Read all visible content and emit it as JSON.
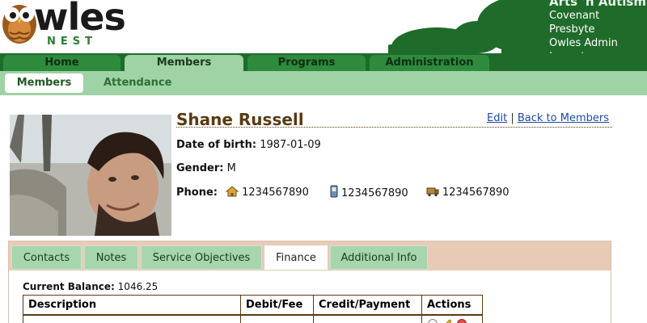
{
  "header": {
    "logo_main": "wles",
    "logo_sub": "NEST",
    "org_name": "Arts 'n Autism",
    "org_sub": "Covenant Presbyte",
    "user_name": "Owles Admin",
    "logout_label": "Logout"
  },
  "main_nav": {
    "tabs": [
      {
        "label": "Home"
      },
      {
        "label": "Members"
      },
      {
        "label": "Programs"
      },
      {
        "label": "Administration"
      }
    ],
    "active": "Members"
  },
  "sub_nav": {
    "tabs": [
      {
        "label": "Members"
      },
      {
        "label": "Attendance"
      }
    ],
    "active": "Members"
  },
  "profile": {
    "name": "Shane Russell",
    "edit_label": "Edit",
    "separator": "|",
    "back_label": "Back to Members",
    "dob_label": "Date of birth:",
    "dob_value": "1987-01-09",
    "gender_label": "Gender:",
    "gender_value": "M",
    "phone_label": "Phone:",
    "phones": [
      {
        "icon": "home-phone-icon",
        "number": "1234567890"
      },
      {
        "icon": "mobile-phone-icon",
        "number": "1234567890"
      },
      {
        "icon": "work-phone-icon",
        "number": "1234567890"
      }
    ]
  },
  "panel": {
    "tabs": [
      {
        "label": "Contacts"
      },
      {
        "label": "Notes"
      },
      {
        "label": "Service Objectives"
      },
      {
        "label": "Finance"
      },
      {
        "label": "Additional Info"
      }
    ],
    "active": "Finance",
    "balance_label": "Current Balance:",
    "balance_value": "1046.25",
    "table": {
      "headers": [
        "Description",
        "Debit/Fee",
        "Credit/Payment",
        "Actions"
      ]
    }
  },
  "colors": {
    "nav_dark": "#1f6b2a",
    "nav_tab": "#2e8b3e",
    "nav_active": "#9fd2a4",
    "name_brown": "#5a3a12",
    "link_blue": "#1f4aa8",
    "panel_tan": "#e8cbb7"
  }
}
